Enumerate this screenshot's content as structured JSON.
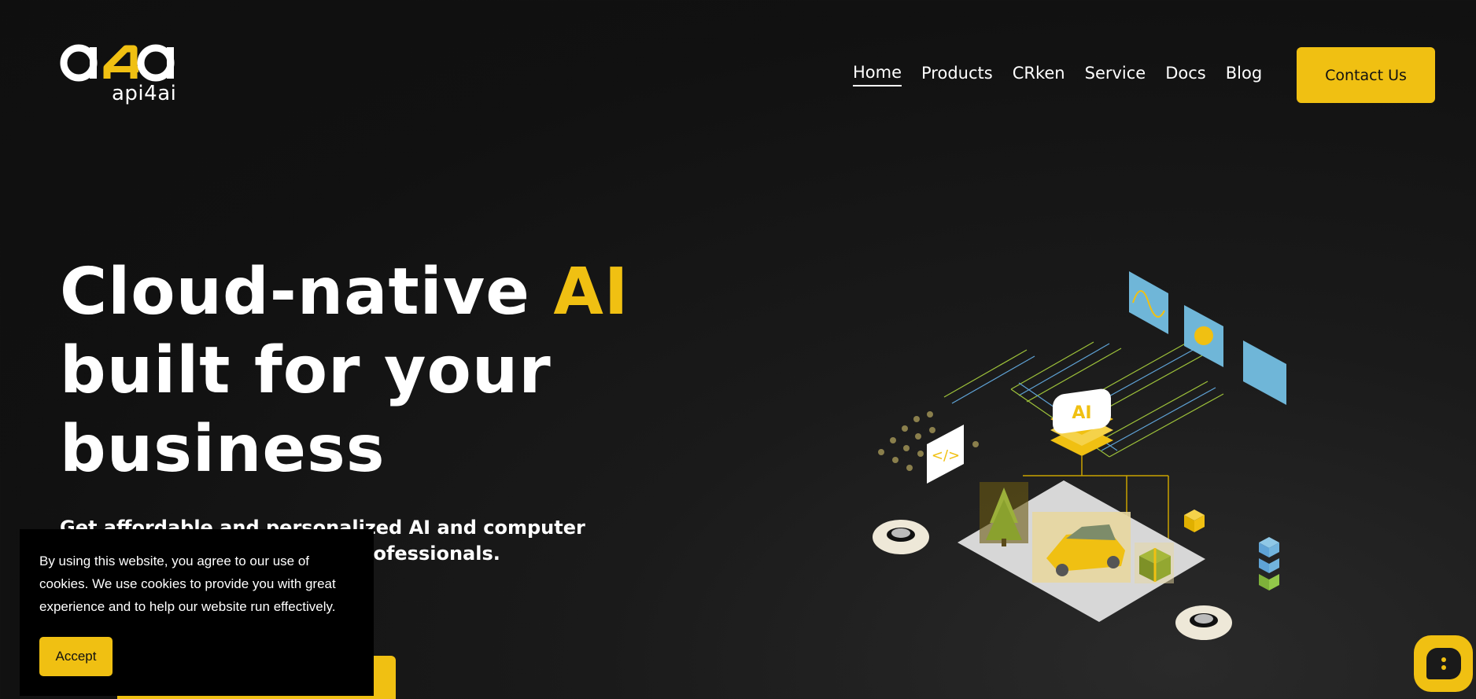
{
  "brand": {
    "logo_text": "api4ai",
    "accent_color": "#f0c012"
  },
  "nav": {
    "items": [
      {
        "label": "Home",
        "active": true
      },
      {
        "label": "Products",
        "active": false
      },
      {
        "label": "CRken",
        "active": false
      },
      {
        "label": "Service",
        "active": false
      },
      {
        "label": "Docs",
        "active": false
      },
      {
        "label": "Blog",
        "active": false
      }
    ],
    "contact_label": "Contact Us"
  },
  "hero": {
    "title_line1_a": "Cloud-native ",
    "title_line1_accent": "AI",
    "title_line2": "built for your",
    "title_line3": "business",
    "subtitle": "Get affordable and personalized AI and computer vision solutions trusted by professionals."
  },
  "cookie": {
    "text": "By using this website, you agree to our use of cookies. We use cookies to provide you with great experience and to help our website run effectively.",
    "accept_label": "Accept"
  },
  "illustration": {
    "chip_label": "AI",
    "code_icon_label": "</>"
  },
  "icons": [
    "logo-icon",
    "chat-icon",
    "gear-icon",
    "code-icon",
    "car-icon",
    "tree-icon",
    "gift-icon",
    "chart-icon"
  ]
}
